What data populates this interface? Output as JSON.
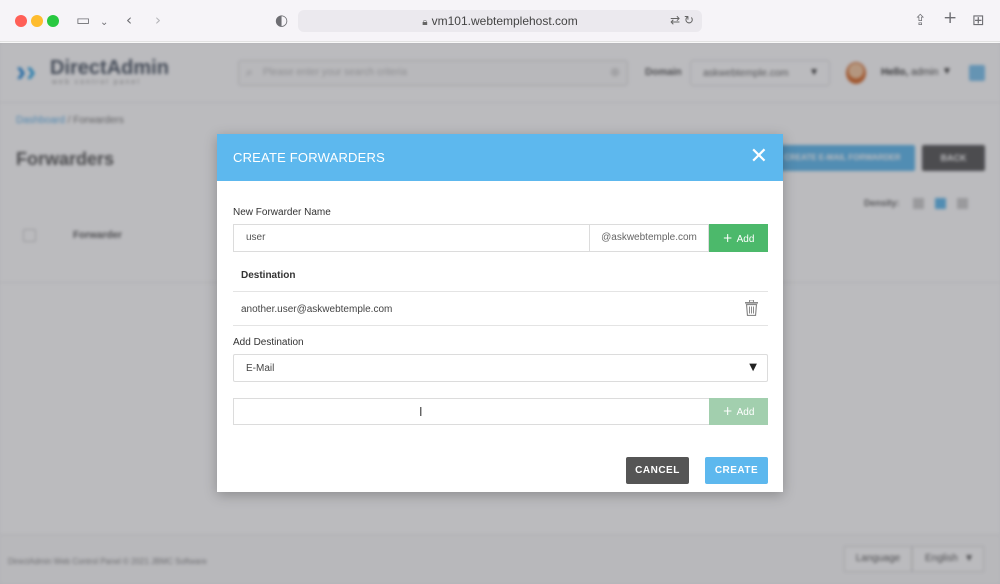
{
  "browser": {
    "url": "vm101.webtemplehost.com",
    "sidebar_icon": "sidebar-icon",
    "back_icon": "back-icon",
    "forward_icon": "forward-icon"
  },
  "app": {
    "logo_name": "DirectAdmin",
    "logo_subtitle": "web control panel",
    "search_placeholder": "Please enter your search criteria",
    "domain_label": "Domain",
    "domain_value": "askwebtemple.com",
    "greeting": "Hello,",
    "username": "admin",
    "breadcrumb_root": "Dashboard",
    "breadcrumb_sep": " / ",
    "breadcrumb_current": "Forwarders",
    "page_title": "Forwarders",
    "create_forwarder_button": "CREATE E-MAIL FORWARDER",
    "back_button": "BACK",
    "density_label": "Density:",
    "table_header": "Forwarder",
    "footer_text": "DirectAdmin Web Control Panel © 2021 JBMC Software",
    "language_button": "Language",
    "language_value": "English"
  },
  "modal": {
    "title": "CREATE FORWARDERS",
    "name_label": "New Forwarder Name",
    "name_value": "user",
    "domain_suffix": "@askwebtemple.com",
    "add_label": "Add",
    "destination_heading": "Destination",
    "destinations": [
      "another.user@askwebtemple.com"
    ],
    "add_destination_label": "Add Destination",
    "destination_type": "E-Mail",
    "destination_input_value": "",
    "add_destination_button": "Add",
    "cancel_button": "CANCEL",
    "create_button": "CREATE"
  },
  "colors": {
    "accent": "#5db8ee",
    "add_green": "#4cb96b",
    "add_green_disabled": "#a2cfae",
    "cancel_gray": "#555555"
  }
}
